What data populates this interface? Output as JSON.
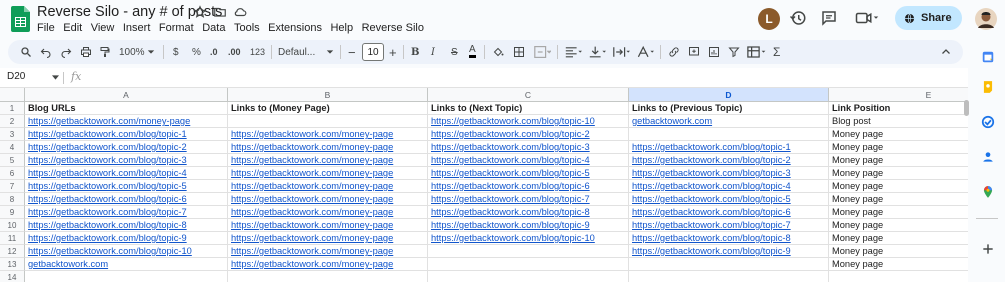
{
  "doc": {
    "title": "Reverse Silo - any # of posts"
  },
  "menu": [
    "File",
    "Edit",
    "View",
    "Insert",
    "Format",
    "Data",
    "Tools",
    "Extensions",
    "Help",
    "Reverse Silo"
  ],
  "header": {
    "avatar_letter": "L",
    "share_label": "Share"
  },
  "toolbar": {
    "zoom": "100%",
    "currency": "$",
    "percent": "%",
    "dec_decrease": ".0",
    "dec_increase": ".00",
    "number_format": "123",
    "font": "Defaul...",
    "font_size": "10",
    "minus": "−",
    "plus": "+",
    "bold": "B",
    "italic": "I",
    "strike": "S",
    "textcolor": "A",
    "sigma": "Σ"
  },
  "formula": {
    "cell_ref": "D20",
    "fx": "fx",
    "value": ""
  },
  "columns": [
    {
      "letter": "A",
      "selected": false
    },
    {
      "letter": "B",
      "selected": false
    },
    {
      "letter": "C",
      "selected": false
    },
    {
      "letter": "D",
      "selected": true
    },
    {
      "letter": "E",
      "selected": false
    }
  ],
  "rows": [
    {
      "num": "1",
      "cells": [
        "Blog URLs",
        "Links to (Money Page)",
        "Links to (Next Topic)",
        "Links to (Previous Topic)",
        "Link Position"
      ]
    },
    {
      "num": "2",
      "cells": [
        "https://getbacktowork.com/money-page",
        "",
        "https://getbacktowork.com/blog/topic-10",
        "getbacktowork.com",
        "Blog post"
      ]
    },
    {
      "num": "3",
      "cells": [
        "https://getbacktowork.com/blog/topic-1",
        "https://getbacktowork.com/money-page",
        "https://getbacktowork.com/blog/topic-2",
        "",
        "Money page"
      ]
    },
    {
      "num": "4",
      "cells": [
        "https://getbacktowork.com/blog/topic-2",
        "https://getbacktowork.com/money-page",
        "https://getbacktowork.com/blog/topic-3",
        "https://getbacktowork.com/blog/topic-1",
        "Money page"
      ]
    },
    {
      "num": "5",
      "cells": [
        "https://getbacktowork.com/blog/topic-3",
        "https://getbacktowork.com/money-page",
        "https://getbacktowork.com/blog/topic-4",
        "https://getbacktowork.com/blog/topic-2",
        "Money page"
      ]
    },
    {
      "num": "6",
      "cells": [
        "https://getbacktowork.com/blog/topic-4",
        "https://getbacktowork.com/money-page",
        "https://getbacktowork.com/blog/topic-5",
        "https://getbacktowork.com/blog/topic-3",
        "Money page"
      ]
    },
    {
      "num": "7",
      "cells": [
        "https://getbacktowork.com/blog/topic-5",
        "https://getbacktowork.com/money-page",
        "https://getbacktowork.com/blog/topic-6",
        "https://getbacktowork.com/blog/topic-4",
        "Money page"
      ]
    },
    {
      "num": "8",
      "cells": [
        "https://getbacktowork.com/blog/topic-6",
        "https://getbacktowork.com/money-page",
        "https://getbacktowork.com/blog/topic-7",
        "https://getbacktowork.com/blog/topic-5",
        "Money page"
      ]
    },
    {
      "num": "9",
      "cells": [
        "https://getbacktowork.com/blog/topic-7",
        "https://getbacktowork.com/money-page",
        "https://getbacktowork.com/blog/topic-8",
        "https://getbacktowork.com/blog/topic-6",
        "Money page"
      ]
    },
    {
      "num": "10",
      "cells": [
        "https://getbacktowork.com/blog/topic-8",
        "https://getbacktowork.com/money-page",
        "https://getbacktowork.com/blog/topic-9",
        "https://getbacktowork.com/blog/topic-7",
        "Money page"
      ]
    },
    {
      "num": "11",
      "cells": [
        "https://getbacktowork.com/blog/topic-9",
        "https://getbacktowork.com/money-page",
        "https://getbacktowork.com/blog/topic-10",
        "https://getbacktowork.com/blog/topic-8",
        "Money page"
      ]
    },
    {
      "num": "12",
      "cells": [
        "https://getbacktowork.com/blog/topic-10",
        "https://getbacktowork.com/money-page",
        "",
        "https://getbacktowork.com/blog/topic-9",
        "Money page"
      ]
    },
    {
      "num": "13",
      "cells": [
        "getbacktowork.com",
        "https://getbacktowork.com/money-page",
        "",
        "",
        "Money page"
      ]
    },
    {
      "num": "14",
      "cells": [
        "",
        "",
        "",
        "",
        ""
      ]
    }
  ],
  "colors": {
    "link": "#1155cc",
    "share_bg": "#c2e7ff",
    "selected_col": "#d3e3fd",
    "sheets_green": "#0f9d58"
  }
}
